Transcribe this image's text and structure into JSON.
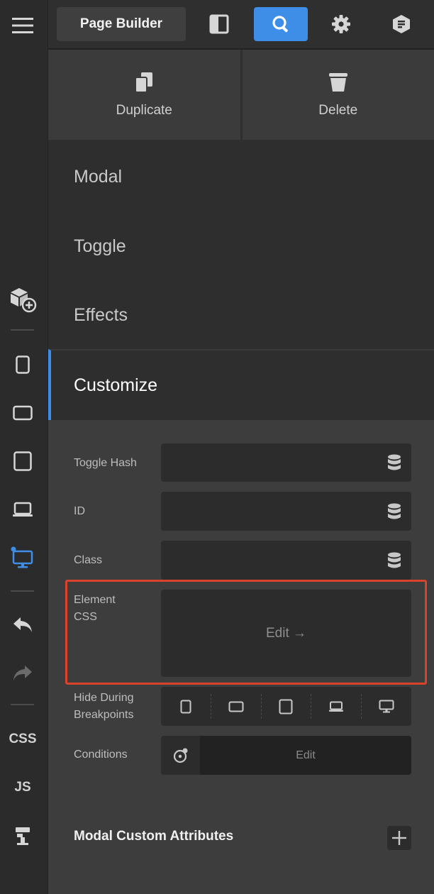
{
  "rail": {
    "css_label": "CSS",
    "js_label": "JS"
  },
  "topbar": {
    "page_builder_label": "Page Builder"
  },
  "actions": {
    "duplicate_label": "Duplicate",
    "delete_label": "Delete"
  },
  "sections": {
    "modal": "Modal",
    "toggle": "Toggle",
    "effects": "Effects",
    "customize": "Customize"
  },
  "fields": {
    "toggle_hash_label": "Toggle Hash",
    "id_label": "ID",
    "class_label": "Class",
    "element_css_label_1": "Element",
    "element_css_label_2": "CSS",
    "element_css_edit": "Edit →",
    "hide_bp_label_1": "Hide During",
    "hide_bp_label_2": "Breakpoints",
    "conditions_label": "Conditions",
    "conditions_edit": "Edit"
  },
  "attributes": {
    "title": "Modal Custom Attributes"
  },
  "colors": {
    "accent": "#3e8ee8",
    "highlight": "#d9432b"
  }
}
